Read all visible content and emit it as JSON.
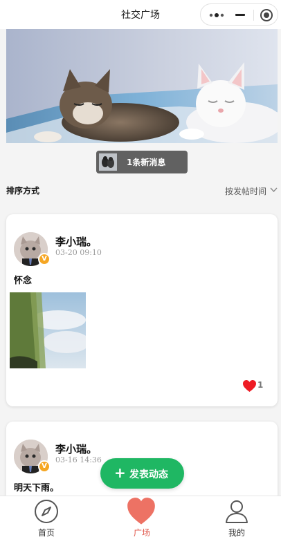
{
  "navbar": {
    "title": "社交广场",
    "capsule_icons": [
      "more-dots-icon",
      "minimize-icon",
      "close-target-icon"
    ]
  },
  "banner": {
    "image": "two-sleeping-kittens"
  },
  "new_message": {
    "label": "1条新消息",
    "icon": "avatar-thumbnail"
  },
  "sort": {
    "label": "排序方式",
    "value": "按发帖时间",
    "icon": "chevron-down-icon"
  },
  "posts": [
    {
      "user": "李小瑞。",
      "time": "03-20 09:10",
      "badge": "V",
      "text": "怀念",
      "image": "sky-landscape-photo",
      "likes": "1"
    },
    {
      "user": "李小瑞。",
      "time": "03-16 14:36",
      "badge": "V",
      "text": "明天下雨。"
    }
  ],
  "fab": {
    "icon": "+",
    "label": "发表动态"
  },
  "tabbar": {
    "items": [
      {
        "label": "首页",
        "icon": "compass-icon",
        "active": false
      },
      {
        "label": "广场",
        "icon": "heart-icon",
        "active": true
      },
      {
        "label": "我的",
        "icon": "person-icon",
        "active": false
      }
    ]
  },
  "colors": {
    "accent": "#1fb763",
    "active_tab": "#e0564a",
    "like": "#ee1c25",
    "badge": "#f5a623"
  }
}
